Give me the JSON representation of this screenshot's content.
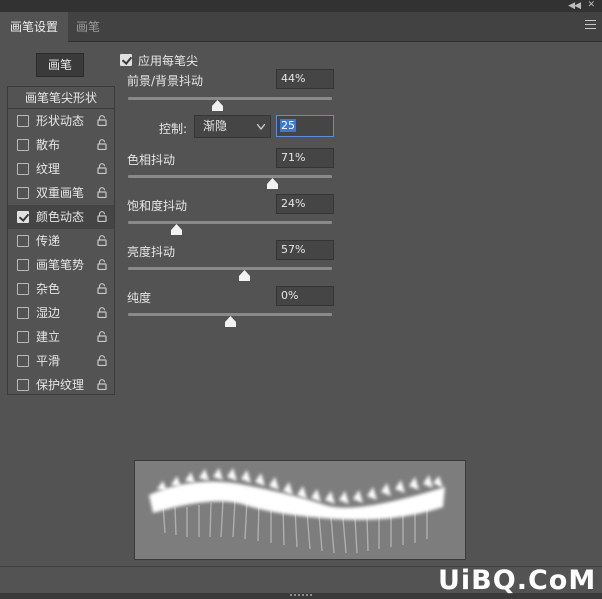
{
  "window": {
    "collapse_icon": "double-chevron-left-icon",
    "close_icon": "close-icon"
  },
  "tabs": [
    {
      "label": "画笔设置",
      "active": true
    },
    {
      "label": "画笔",
      "active": false
    }
  ],
  "menu_icon": "hamburger-menu-icon",
  "brushes_button": "画笔",
  "sidebar": {
    "tip_shape": "画笔笔尖形状",
    "items": [
      {
        "label": "形状动态",
        "checked": false,
        "selected": false
      },
      {
        "label": "散布",
        "checked": false,
        "selected": false
      },
      {
        "label": "纹理",
        "checked": false,
        "selected": false
      },
      {
        "label": "双重画笔",
        "checked": false,
        "selected": false
      },
      {
        "label": "颜色动态",
        "checked": true,
        "selected": true
      },
      {
        "label": "传递",
        "checked": false,
        "selected": false
      },
      {
        "label": "画笔笔势",
        "checked": false,
        "selected": false
      },
      {
        "label": "杂色",
        "checked": false,
        "selected": false
      },
      {
        "label": "湿边",
        "checked": false,
        "selected": false
      },
      {
        "label": "建立",
        "checked": false,
        "selected": false
      },
      {
        "label": "平滑",
        "checked": false,
        "selected": false
      },
      {
        "label": "保护纹理",
        "checked": false,
        "selected": false
      }
    ]
  },
  "apply_per_tip": {
    "label": "应用每笔尖",
    "checked": true
  },
  "params": [
    {
      "label": "前景/背景抖动",
      "value": "44%",
      "level": 0.44
    },
    {
      "label": "色相抖动",
      "value": "71%",
      "level": 0.71
    },
    {
      "label": "饱和度抖动",
      "value": "24%",
      "level": 0.24
    },
    {
      "label": "亮度抖动",
      "value": "57%",
      "level": 0.57
    },
    {
      "label": "纯度",
      "value": "0%",
      "level": 0.5
    }
  ],
  "control": {
    "label": "控制:",
    "selected": "渐隐",
    "value": "25"
  },
  "watermark": "UiBQ.CoM",
  "colors": {
    "panel_bg": "#535353",
    "tab_bar": "#424242",
    "selection_blue": "#3b79d4"
  }
}
